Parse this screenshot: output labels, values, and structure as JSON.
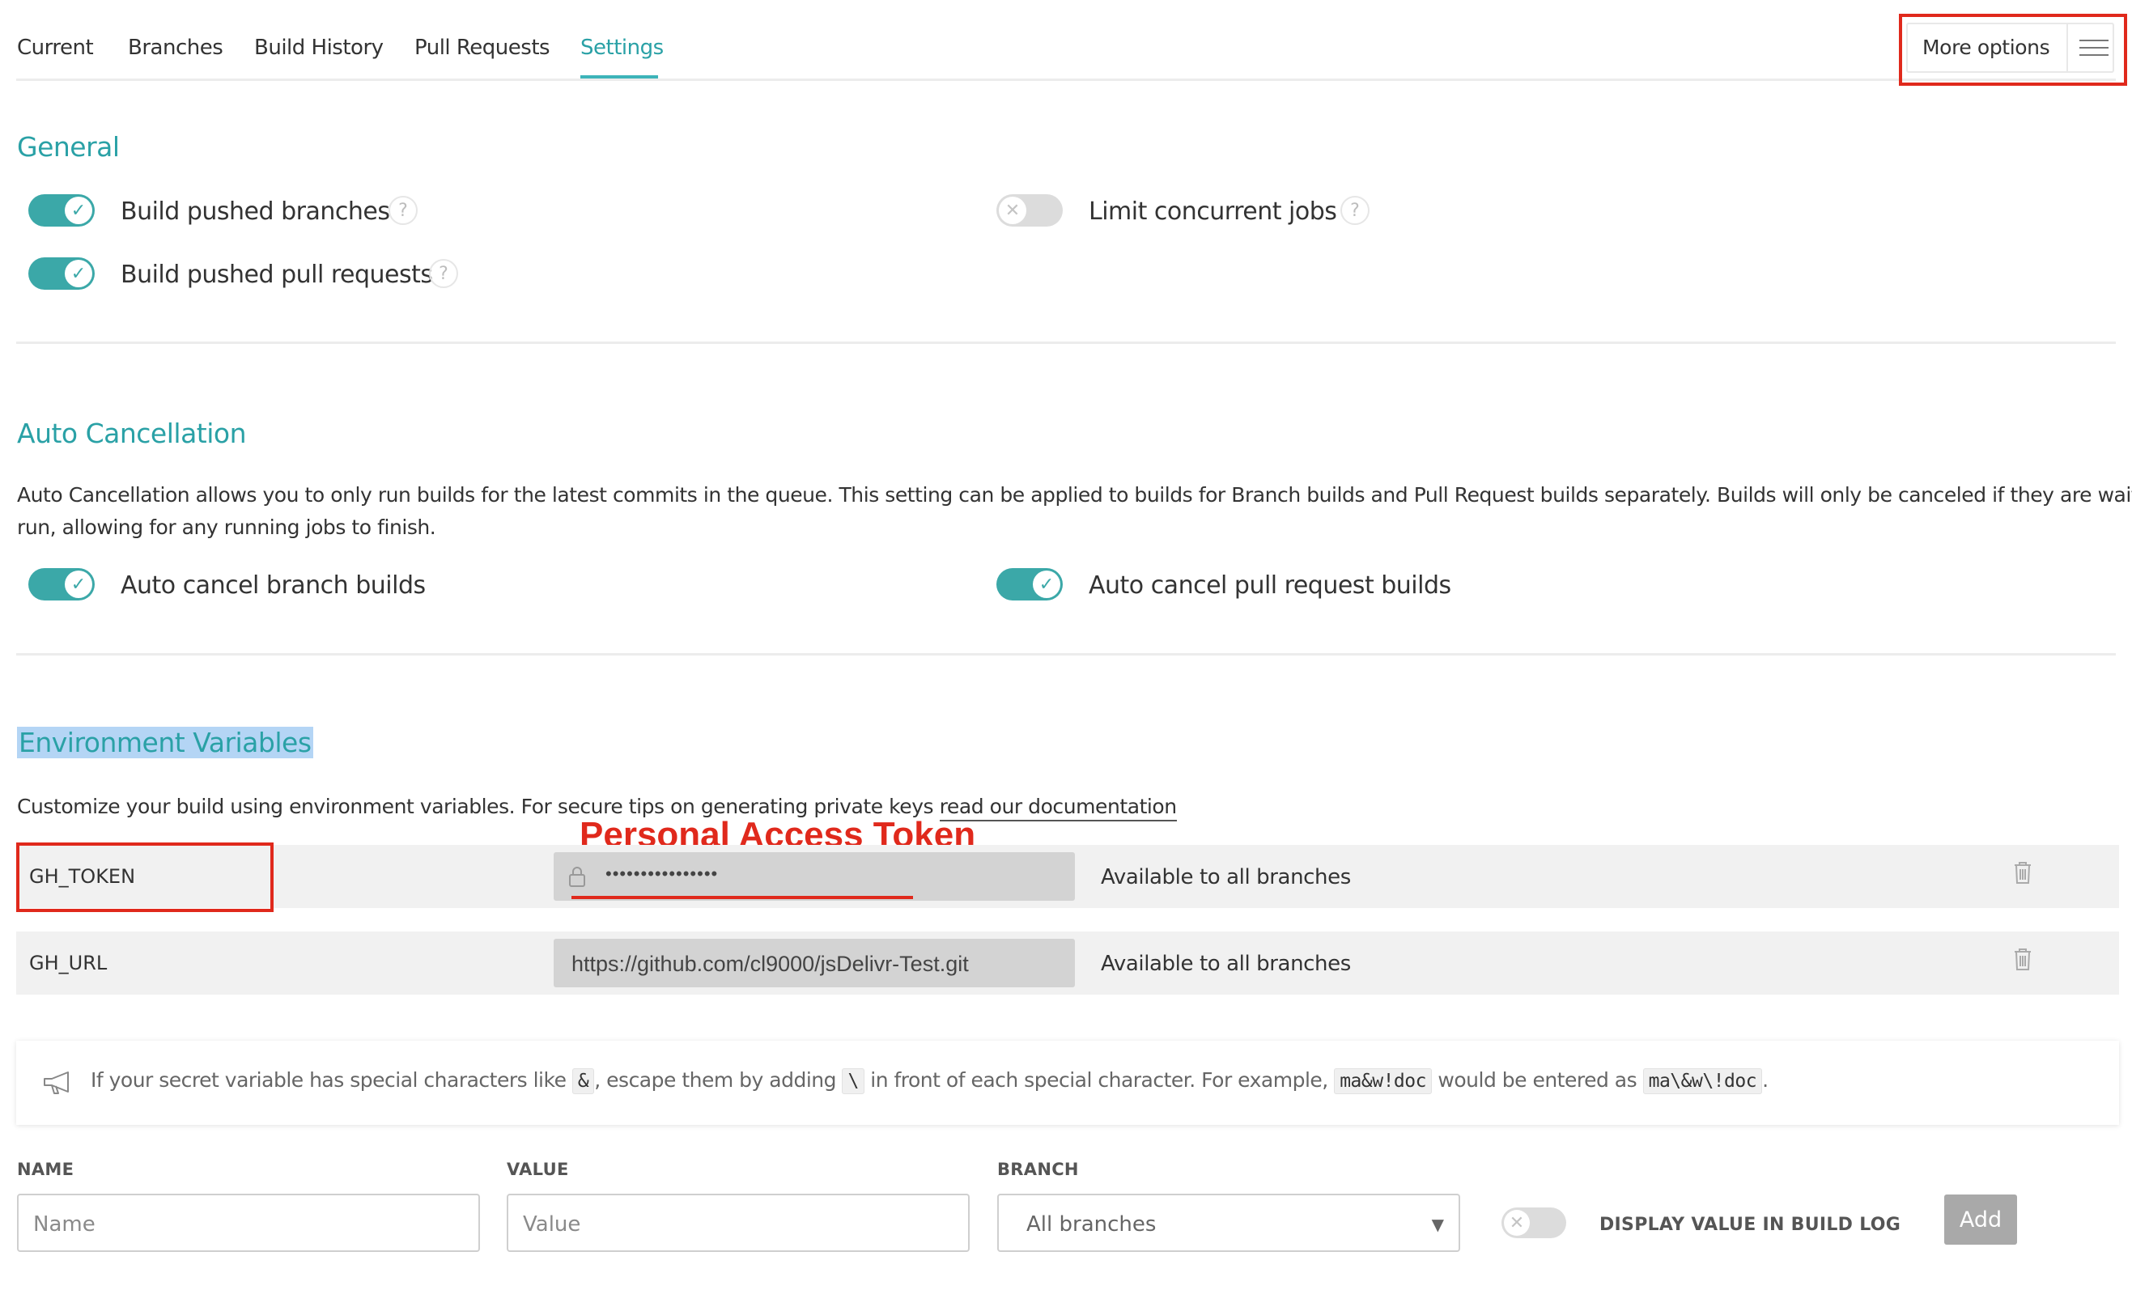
{
  "tabs": [
    {
      "label": "Current"
    },
    {
      "label": "Branches"
    },
    {
      "label": "Build History"
    },
    {
      "label": "Pull Requests"
    },
    {
      "label": "Settings",
      "active": true
    }
  ],
  "more_options": {
    "label": "More options",
    "icon": "hamburger-menu-icon"
  },
  "general": {
    "title": "General",
    "options": [
      {
        "label": "Build pushed branches",
        "enabled": true
      },
      {
        "label": "Build pushed pull requests",
        "enabled": true
      },
      {
        "label": "Limit concurrent jobs",
        "enabled": false
      }
    ],
    "help_glyph": "?"
  },
  "auto_cancellation": {
    "title": "Auto Cancellation",
    "description_line1": "Auto Cancellation allows you to only run builds for the latest commits in the queue. This setting can be applied to builds for Branch builds and Pull Request builds separately. Builds will only be canceled if they are waiting to",
    "description_line2": "run, allowing for any running jobs to finish.",
    "options": [
      {
        "label": "Auto cancel branch builds",
        "enabled": true
      },
      {
        "label": "Auto cancel pull request builds",
        "enabled": true
      }
    ]
  },
  "env_vars": {
    "title": "Environment Variables",
    "description": "Customize your build using environment variables. For secure tips on generating private keys ",
    "doc_link": "read our documentation",
    "annotation": "Personal Access Token",
    "rows": [
      {
        "name": "GH_TOKEN",
        "value": "••••••••••••••••",
        "secret": true,
        "branch": "Available to all branches"
      },
      {
        "name": "GH_URL",
        "value": "https://github.com/cl9000/jsDelivr-Test.git",
        "secret": false,
        "branch": "Available to all branches"
      }
    ],
    "notice": {
      "part1": "If your secret variable has special characters like ",
      "code1": "&",
      "part2": ", escape them by adding ",
      "code2": "\\",
      "part3": " in front of each special character. For example, ",
      "code3": "ma&w!doc",
      "part4": " would be entered as ",
      "code4": "ma\\&w\\!doc",
      "part5": "."
    }
  },
  "form": {
    "name_label": "NAME",
    "name_placeholder": "Name",
    "value_label": "VALUE",
    "value_placeholder": "Value",
    "branch_label": "BRANCH",
    "branch_selected": "All branches",
    "display_toggle_label": "DISPLAY VALUE IN BUILD LOG",
    "display_enabled": false,
    "add_label": "Add"
  },
  "colors": {
    "accent": "#2aa1a6",
    "toggle_on": "#3ba8a8",
    "annotation_red": "#e0291c"
  }
}
